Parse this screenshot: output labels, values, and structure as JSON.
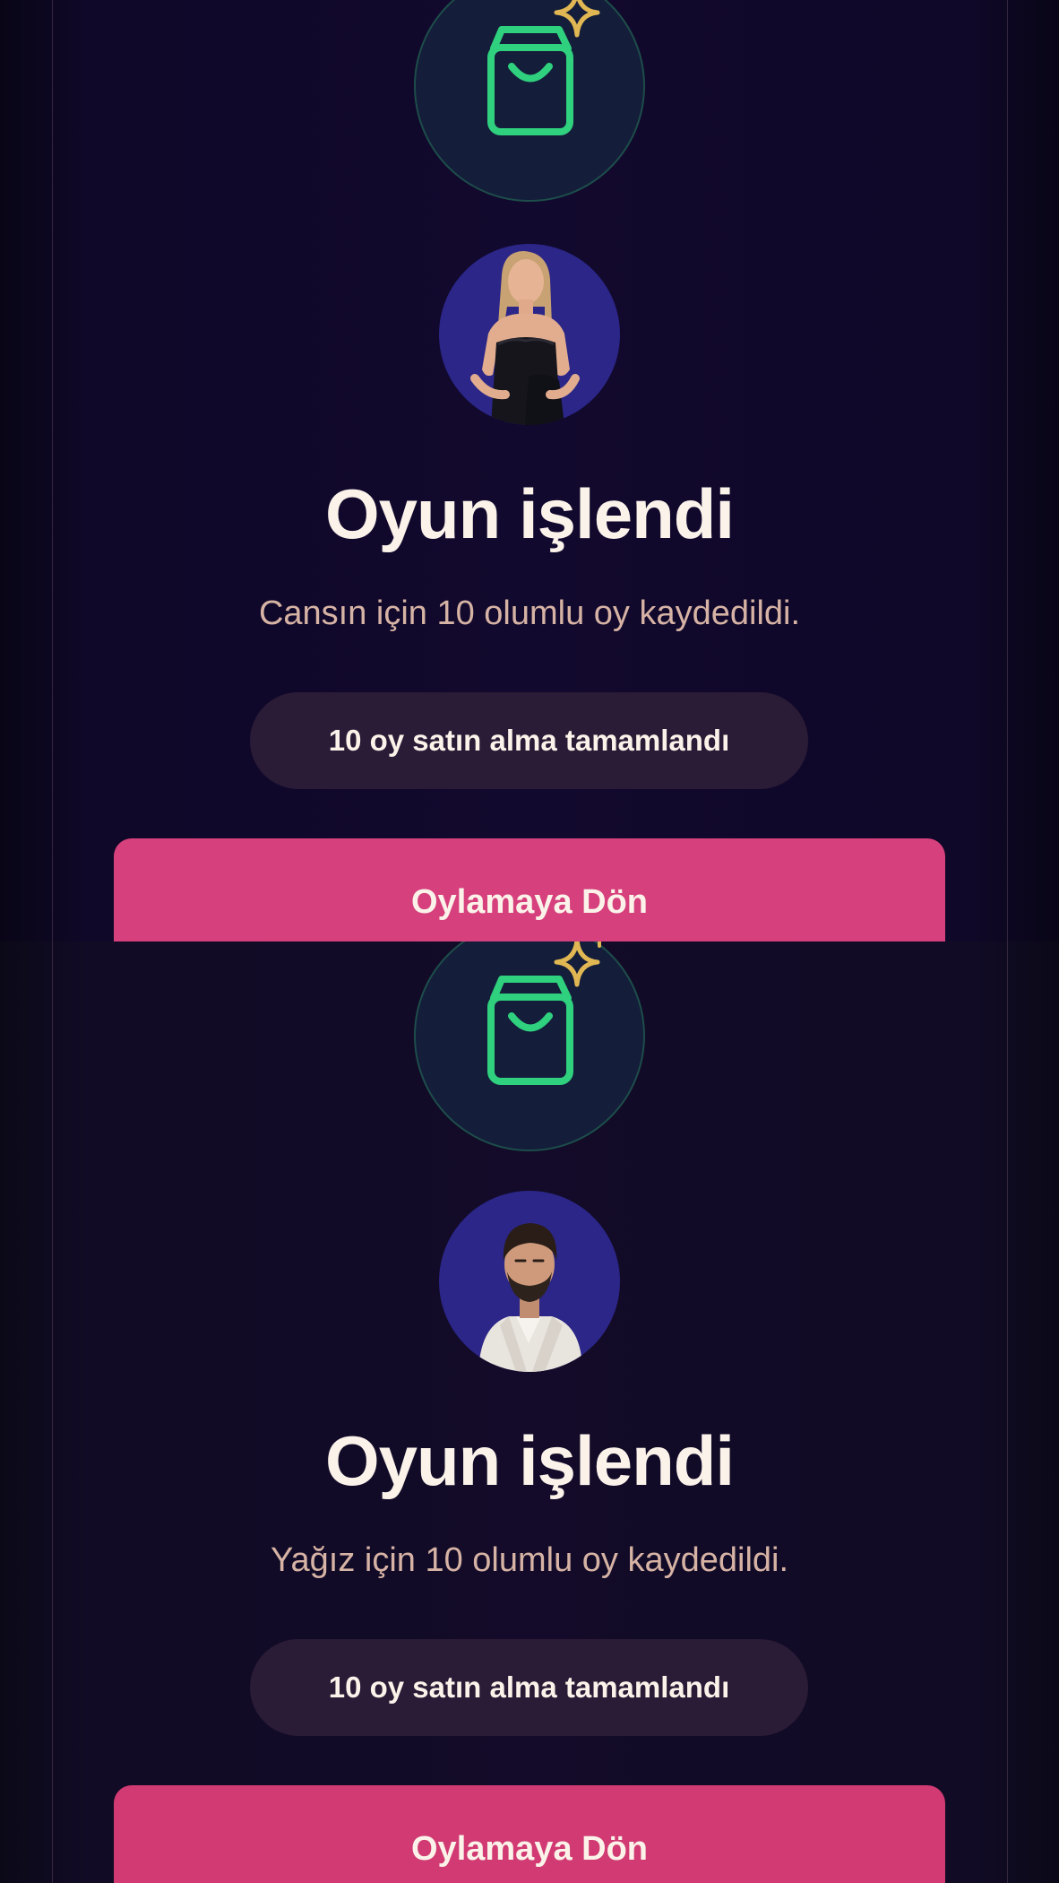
{
  "colors": {
    "background": "#12092e",
    "icon_green": "#2fd07e",
    "sparkle_gold": "#e1b753",
    "avatar_bg": "#2b2687",
    "title": "#fbf3ea",
    "subtitle": "#d6b3a4",
    "pill_bg": "#2a1b36",
    "cta_bg": "#d6407d"
  },
  "screens": [
    {
      "icon": "shopping-bag-sparkle-icon",
      "avatar": "contestant-photo-cansin",
      "title": "Oyun işlendi",
      "message": "Cansın için 10 olumlu oy kaydedildi.",
      "status_pill": "10 oy satın alma tamamlandı",
      "button_label": "Oylamaya Dön"
    },
    {
      "icon": "shopping-bag-sparkle-icon",
      "avatar": "contestant-photo-yagiz",
      "title": "Oyun işlendi",
      "message": "Yağız için 10 olumlu oy kaydedildi.",
      "status_pill": "10 oy satın alma tamamlandı",
      "button_label": "Oylamaya Dön"
    }
  ]
}
